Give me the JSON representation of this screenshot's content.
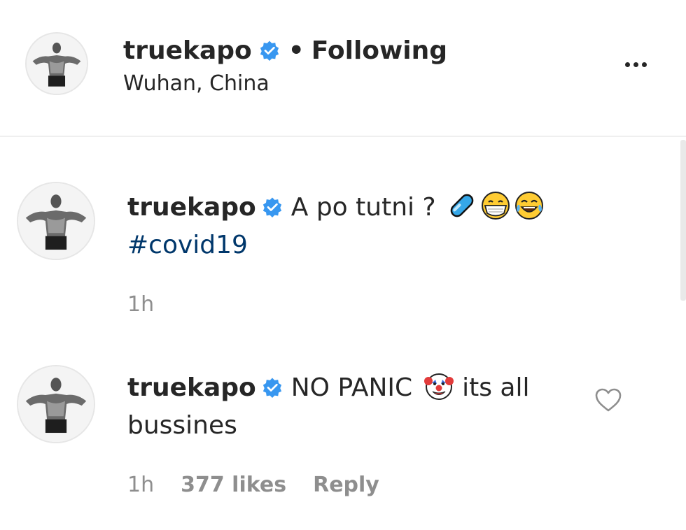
{
  "header": {
    "username": "truekapo",
    "separator": "•",
    "follow_status": "Following",
    "location": "Wuhan, China"
  },
  "comments": [
    {
      "username": "truekapo",
      "text": "A po tutni ?",
      "hashtag": "#covid19",
      "time": "1h",
      "icons": [
        "pill-emoji",
        "mask-face-emoji",
        "tears-of-joy-emoji"
      ]
    },
    {
      "username": "truekapo",
      "text_before": "NO PANIC",
      "text_after": "its all bussines",
      "time": "1h",
      "likes": "377 likes",
      "reply": "Reply",
      "icons": [
        "clown-face-emoji"
      ]
    }
  ],
  "colors": {
    "verified": "#3897f0",
    "hashtag": "#00376b",
    "muted": "#8e8e8e",
    "text": "#262626"
  }
}
